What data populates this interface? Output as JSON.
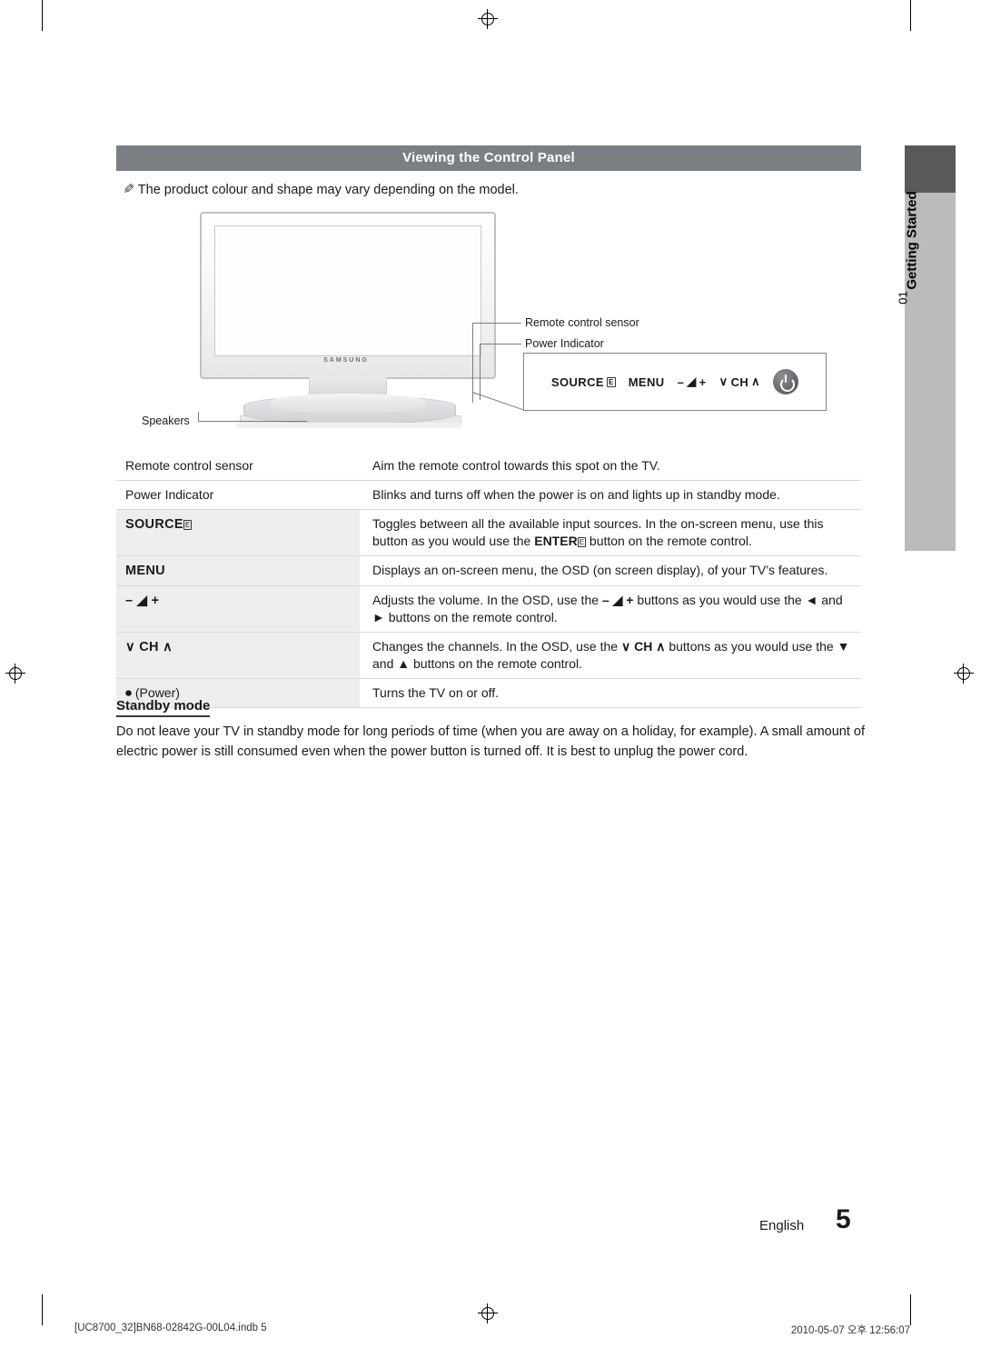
{
  "header": {
    "title": "Viewing the Control Panel"
  },
  "side_tab": {
    "number": "01",
    "label": "Getting Started"
  },
  "note": {
    "icon": "note-pencil-icon",
    "text": "The product colour and shape may vary depending on the model."
  },
  "illustration": {
    "tv_brand": "SAMSUNG",
    "callouts": [
      {
        "name": "remote-control-sensor",
        "text": "Remote control sensor"
      },
      {
        "name": "power-indicator",
        "text": "Power Indicator"
      },
      {
        "name": "speakers",
        "text": "Speakers"
      }
    ],
    "control_panel": {
      "source_label": "SOURCE",
      "source_glyph": "E",
      "menu_label": "MENU",
      "volume_minus": "–",
      "volume_icon": "volume-speaker-icon",
      "volume_plus": "+",
      "ch_down": "∨",
      "ch_label": "CH",
      "ch_up": "∧",
      "power": "power-icon"
    }
  },
  "table": {
    "rows": [
      {
        "key": "Remote control sensor",
        "key_style": "plain",
        "value": "Aim the remote control towards this spot on the TV."
      },
      {
        "key": "Power Indicator",
        "key_style": "plain",
        "value": "Blinks and turns off when the power is on and lights up in standby mode."
      },
      {
        "key": "SOURCE",
        "key_style": "bold-shaded",
        "value_part1": "Toggles between all the available input sources. In the on-screen menu, use this button as you would use the ",
        "value_strong": "ENTER",
        "value_part2": " button on the remote control."
      },
      {
        "key": "MENU",
        "key_style": "bold-shaded",
        "value": "Displays an on-screen menu, the OSD (on screen display), of your TV’s features."
      },
      {
        "key": "–  ◢  +",
        "key_style": "bold-shaded",
        "value_part1": "Adjusts the volume. In the OSD, use the ",
        "value_inline": "–  ◢  +",
        "value_part2": " buttons as you would use the ◄ and ► buttons on the remote control."
      },
      {
        "key": "∨  CH  ∧",
        "key_style": "bold-shaded",
        "value_part1": "Changes the channels. In the OSD, use the ",
        "value_inline": "∨  CH  ∧",
        "value_part2": " buttons as you would use the ▼ and ▲ buttons on the remote control."
      },
      {
        "key": "(Power)",
        "key_style": "plain-power",
        "value": "Turns the TV on or off."
      }
    ]
  },
  "standby": {
    "heading": "Standby mode",
    "body": "Do not leave your TV in standby mode for long periods of time (when you are away on a holiday, for example). A small amount of electric power is still consumed even when the power button is turned off. It is best to unplug the power cord."
  },
  "footer": {
    "language": "English",
    "page_number": "5",
    "file_info": "[UC8700_32]BN68-02842G-00L04.indb   5",
    "timestamp": "2010-05-07   오후 12:56:07"
  }
}
